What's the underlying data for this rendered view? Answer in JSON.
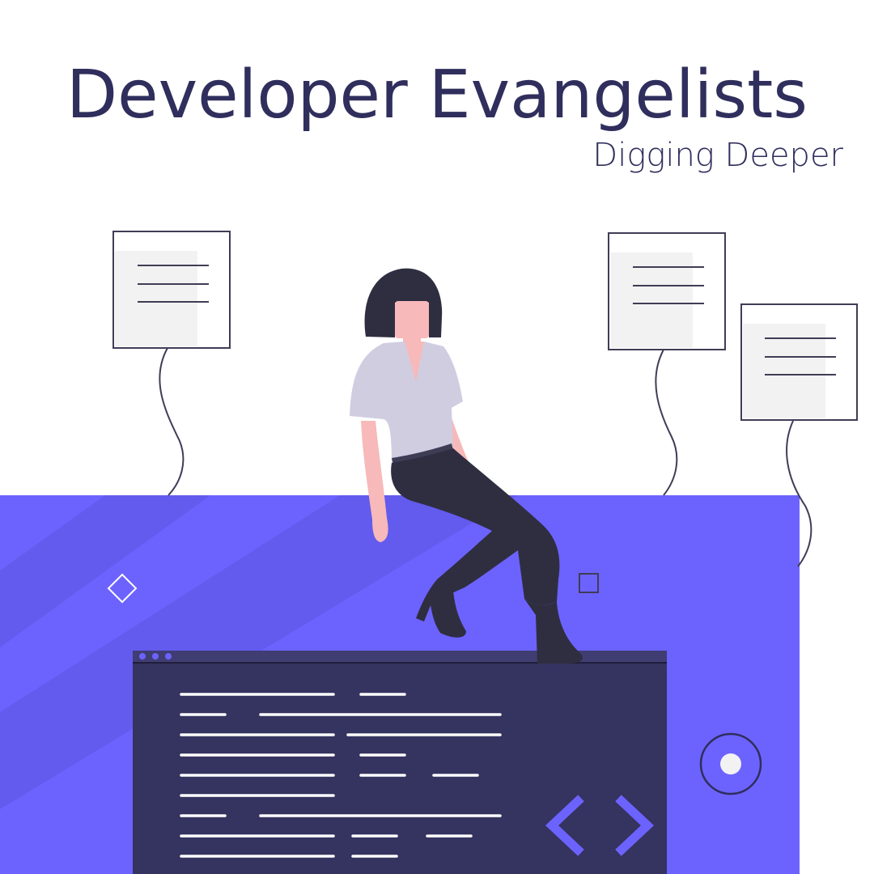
{
  "header": {
    "title": "Developer Evangelists",
    "subtitle": "Digging Deeper"
  },
  "colors": {
    "title_text": "#2f2e5c",
    "stage_purple": "#6c63ff",
    "code_window": "#35335f",
    "skin": "#f7b9b9",
    "hair_and_pants": "#2f2e41",
    "shirt": "#d0cde1",
    "paper": "#f2f2f2",
    "lines": "#3f3d56"
  },
  "icons": [
    "diamond-icon",
    "square-outline-icon",
    "circle-target-icon",
    "code-brackets-icon"
  ]
}
